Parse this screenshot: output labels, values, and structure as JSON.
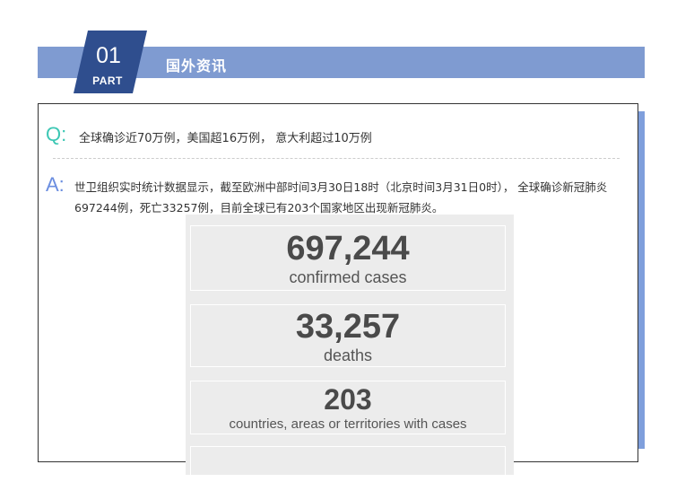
{
  "header": {
    "part_number": "01",
    "part_word": "PART",
    "title": "国外资讯"
  },
  "qa": {
    "q_mark": "Q:",
    "question": "全球确诊近70万例，美国超16万例， 意大利超过10万例",
    "a_mark": "A:",
    "answer": "世卫组织实时统计数据显示，截至欧洲中部时间3月30日18时（北京时间3月31日0时）， 全球确诊新冠肺炎697244例，死亡33257例，目前全球已有203个国家地区出现新冠肺炎。"
  },
  "stats": [
    {
      "value": "697,244",
      "label": "confirmed cases"
    },
    {
      "value": "33,257",
      "label": "deaths"
    },
    {
      "value": "203",
      "label": "countries, areas or territories with cases"
    }
  ],
  "colors": {
    "header_bar": "#7f9bd1",
    "badge": "#2f4e8e",
    "q_accent": "#3dc7b4",
    "a_accent": "#6b8ee0",
    "panel": "#ececec"
  }
}
